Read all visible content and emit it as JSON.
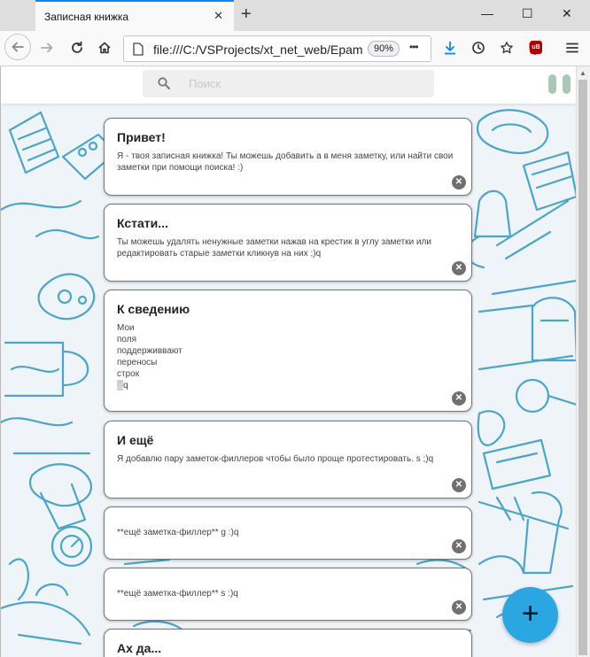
{
  "browser": {
    "tab_title": "Записная книжка",
    "tab_close": "✕",
    "new_tab": "+",
    "url": "file:///C:/VSProjects/xt_net_web/Epam",
    "zoom": "90%",
    "more": "•••",
    "addon_badge": "uB"
  },
  "header": {
    "search_placeholder": "Поиск"
  },
  "notes": [
    {
      "title": "Привет!",
      "text": "Я - твоя записная книжка! Ты можешь добавить а в меня заметку, или найти свои заметки при помощи поиска! :)"
    },
    {
      "title": "Кстати...",
      "text": "Ты можешь удалять ненужные заметки нажав на крестик в углу заметки или редактировать старые заметки кликнув на них ;)q"
    },
    {
      "title": "К сведению",
      "text": "Мои\nполя\nподдерживвают\nпереносы\nстрок\n▒q"
    },
    {
      "title": "И ещё",
      "text": "Я добавлю пару заметок-филлеров чтобы было проще протестировать. s ;)q"
    },
    {
      "title": "",
      "text": "**ещё заметка-филлер** g :)q"
    },
    {
      "title": "",
      "text": "**ещё заметка-филлер** s :)q"
    },
    {
      "title": "Ах да...",
      "text": ""
    }
  ],
  "delete_icon": "✕",
  "fab_label": "+",
  "colors": {
    "accent": "#2aa6e3",
    "pattern": "#4aa6c8",
    "tab_highlight": "#0a84ff"
  }
}
